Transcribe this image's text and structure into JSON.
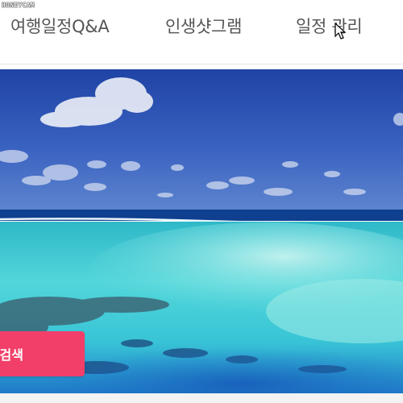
{
  "watermark": "HONEYCAM",
  "nav": {
    "items": [
      {
        "label": "여행일정Q&A"
      },
      {
        "label": "인생샷그램"
      },
      {
        "label": "일정 관리"
      }
    ]
  },
  "hero": {
    "image": "tropical-lagoon-seascape",
    "search_button_label": "검색",
    "accent_color": "#f23f6a"
  },
  "cursor": "arrow-cursor-icon"
}
